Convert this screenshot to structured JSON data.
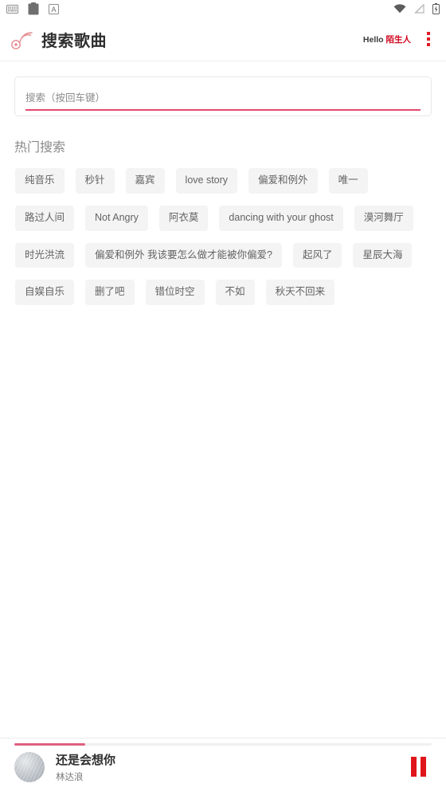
{
  "statusbar": {
    "left_icons": [
      "keyboard-icon",
      "clipboard-icon",
      "letter-a-icon"
    ],
    "right_icons": [
      "wifi-icon",
      "signal-off-icon",
      "battery-charging-icon"
    ]
  },
  "header": {
    "logo_icon": "music-note-logo-icon",
    "title": "搜索歌曲",
    "greeting_prefix": "Hello ",
    "greeting_user": "陌生人",
    "menu_icon": "kebab-menu-icon",
    "accent_color": "#e01b24"
  },
  "search": {
    "value": "",
    "placeholder": "搜索（按回车键）",
    "underline_color": "#e34a6f"
  },
  "hot": {
    "title": "热门搜索",
    "rows": [
      [
        "纯音乐",
        "秒针",
        "嘉宾",
        "love story"
      ],
      [
        "偏爱和例外",
        "唯一",
        "路过人间",
        "Not Angry"
      ],
      [
        "阿衣莫",
        "dancing with your ghost"
      ],
      [
        "漠河舞厅",
        "时光洪流",
        "偏爱和例外 我该要怎么做才能被你偏爱?"
      ],
      [
        "起风了",
        "星辰大海",
        "自娱自乐"
      ],
      [
        "删了吧",
        "错位时空",
        "不如",
        "秋天不回来"
      ]
    ]
  },
  "player": {
    "progress_percent": 17,
    "progress_color": "#e0607e",
    "cover_icon": "album-cover-art",
    "title": "还是会想你",
    "artist": "林达浪",
    "control_icon": "pause-icon",
    "control_color": "#e0151c"
  }
}
